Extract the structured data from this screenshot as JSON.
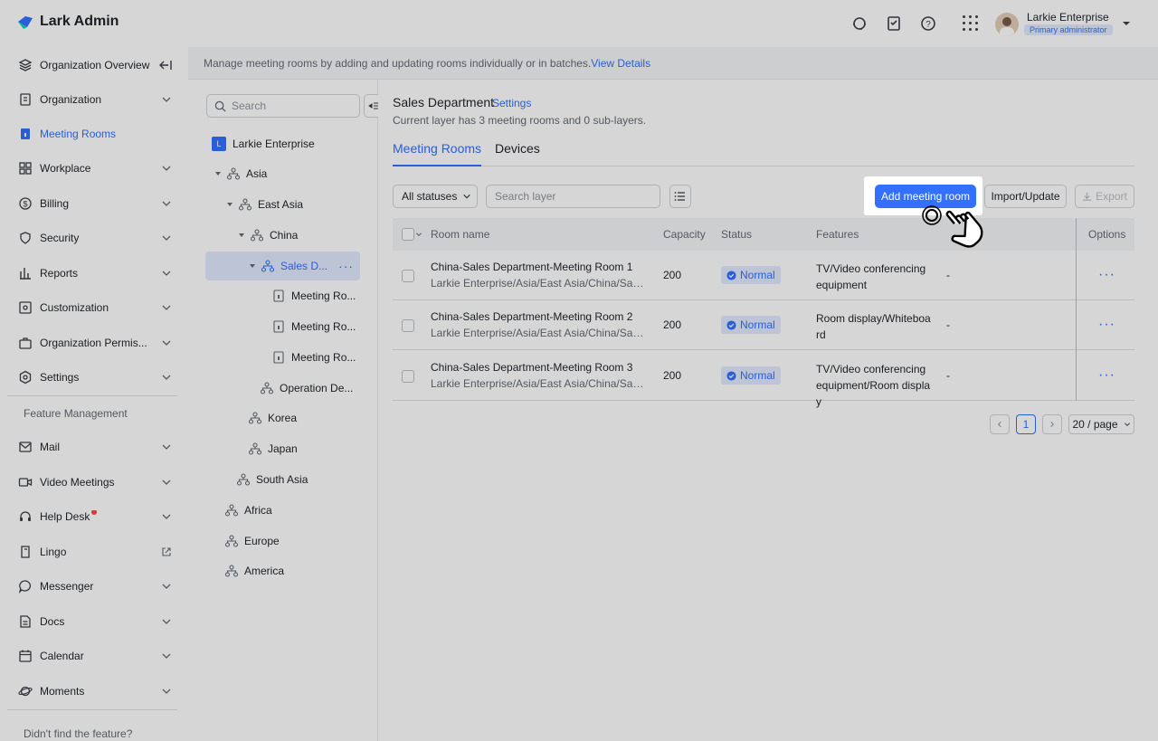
{
  "header": {
    "brand": "Lark Admin",
    "user_name": "Larkie Enterprise",
    "user_role": "Primary administrator"
  },
  "sidebar": {
    "items": [
      {
        "label": "Organization Overview",
        "icon": "layers-icon"
      },
      {
        "label": "Organization",
        "icon": "org-icon"
      },
      {
        "label": "Meeting Rooms",
        "icon": "meeting-room-icon",
        "active": true
      },
      {
        "label": "Workplace",
        "icon": "grid-icon"
      },
      {
        "label": "Billing",
        "icon": "dollar-icon"
      },
      {
        "label": "Security",
        "icon": "shield-icon"
      },
      {
        "label": "Reports",
        "icon": "bar-chart-icon"
      },
      {
        "label": "Customization",
        "icon": "customize-icon"
      },
      {
        "label": "Organization Permis...",
        "icon": "briefcase-icon"
      },
      {
        "label": "Settings",
        "icon": "gear-icon"
      }
    ],
    "section_title": "Feature Management",
    "feature_items": [
      {
        "label": "Mail",
        "icon": "mail-icon"
      },
      {
        "label": "Video Meetings",
        "icon": "video-icon"
      },
      {
        "label": "Help Desk",
        "icon": "headset-icon"
      },
      {
        "label": "Lingo",
        "icon": "book-icon"
      },
      {
        "label": "Messenger",
        "icon": "chat-icon"
      },
      {
        "label": "Docs",
        "icon": "doc-icon"
      },
      {
        "label": "Calendar",
        "icon": "calendar-icon"
      },
      {
        "label": "Moments",
        "icon": "planet-icon"
      }
    ],
    "footer": "Didn't find the feature?"
  },
  "notice": {
    "text": "Manage meeting rooms by adding and updating rooms individually or in batches.",
    "link": "View Details"
  },
  "tree": {
    "search_placeholder": "Search",
    "root": "Larkie Enterprise",
    "root_logo": "L",
    "nodes": {
      "asia": "Asia",
      "east_asia": "East Asia",
      "china": "China",
      "sales": "Sales D...",
      "room1": "Meeting Ro...",
      "room2": "Meeting Ro...",
      "room3": "Meeting Ro...",
      "operation": "Operation De...",
      "korea": "Korea",
      "japan": "Japan",
      "south_asia": "South Asia",
      "africa": "Africa",
      "europe": "Europe",
      "america": "America"
    }
  },
  "main": {
    "title": "Sales Department",
    "settings_link": "Settings",
    "subtitle": "Current layer has 3 meeting rooms and 0 sub-layers.",
    "tabs": [
      "Meeting Rooms",
      "Devices"
    ],
    "filter_label": "All statuses",
    "search_placeholder": "Search layer",
    "add_button": "Add meeting room",
    "import_button": "Import/Update",
    "export_button": "Export",
    "columns": [
      "Room name",
      "Capacity",
      "Status",
      "Features",
      "Options"
    ],
    "rows": [
      {
        "name": "China-Sales Department-Meeting Room 1",
        "path": "Larkie Enterprise/Asia/East Asia/China/Sales Department",
        "capacity": "200",
        "status": "Normal",
        "features": "TV/Video conferencing equipment",
        "extra": "-"
      },
      {
        "name": "China-Sales Department-Meeting Room 2",
        "path": "Larkie Enterprise/Asia/East Asia/China/Sales Department",
        "capacity": "200",
        "status": "Normal",
        "features": "Room display/Whiteboard",
        "extra": "-"
      },
      {
        "name": "China-Sales Department-Meeting Room 3",
        "path": "Larkie Enterprise/Asia/East Asia/China/Sales Department",
        "capacity": "200",
        "status": "Normal",
        "features": "TV/Video conferencing equipment/Room display",
        "extra": "-"
      }
    ],
    "pagination": {
      "current_page": "1",
      "page_size": "20 / page"
    }
  },
  "colors": {
    "accent": "#3370ff",
    "danger": "#f54a45"
  }
}
